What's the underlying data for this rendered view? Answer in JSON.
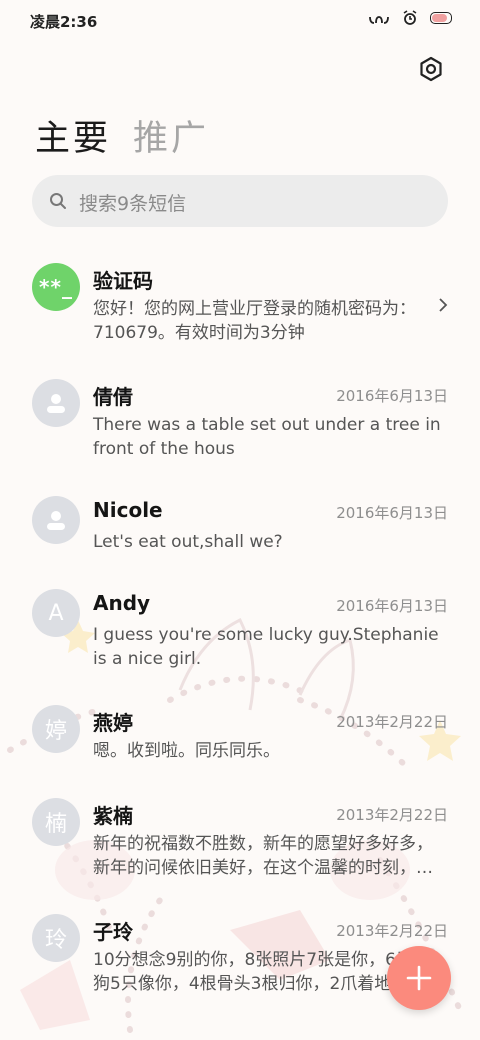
{
  "status_bar": {
    "time": "凌晨2:36"
  },
  "tabs": [
    {
      "label": "主要",
      "active": true
    },
    {
      "label": "推广",
      "active": false
    }
  ],
  "search": {
    "placeholder": "搜索9条短信"
  },
  "conversations": [
    {
      "name": "验证码",
      "avatar": "**_",
      "avatar_color": "#6fd36a",
      "date": "",
      "preview": "您好！您的网上营业厅登录的随机密码为：710679。有效时间为3分钟"
    },
    {
      "name": "倩倩",
      "avatar": "person-icon",
      "date": "2016年6月13日",
      "preview": "There was a table set out under a tree in front of the hous"
    },
    {
      "name": "Nicole",
      "avatar": "person-icon",
      "date": "2016年6月13日",
      "preview": "Let's eat out,shall we?"
    },
    {
      "name": "Andy",
      "avatar": "A",
      "date": "2016年6月13日",
      "preview": "I guess you're some lucky guy.Stephanie is a nice girl."
    },
    {
      "name": "燕婷",
      "avatar": "婷",
      "date": "2013年2月22日",
      "preview": "嗯。收到啦。同乐同乐。"
    },
    {
      "name": "紫楠",
      "avatar": "楠",
      "date": "2013年2月22日",
      "preview": "新年的祝福数不胜数，新年的愿望好多好多，新年的问候依旧美好，在这个温馨的时刻，…"
    },
    {
      "name": "子玲",
      "avatar": "玲",
      "date": "2013年2月22日",
      "preview": "10分想念9别的你，8张照片7张是你，6只小狗5只像你，4根骨头3根归你，2爪着地"
    }
  ],
  "colors": {
    "fab": "#fb8a7d",
    "avatar_default": "#dcdee3"
  }
}
